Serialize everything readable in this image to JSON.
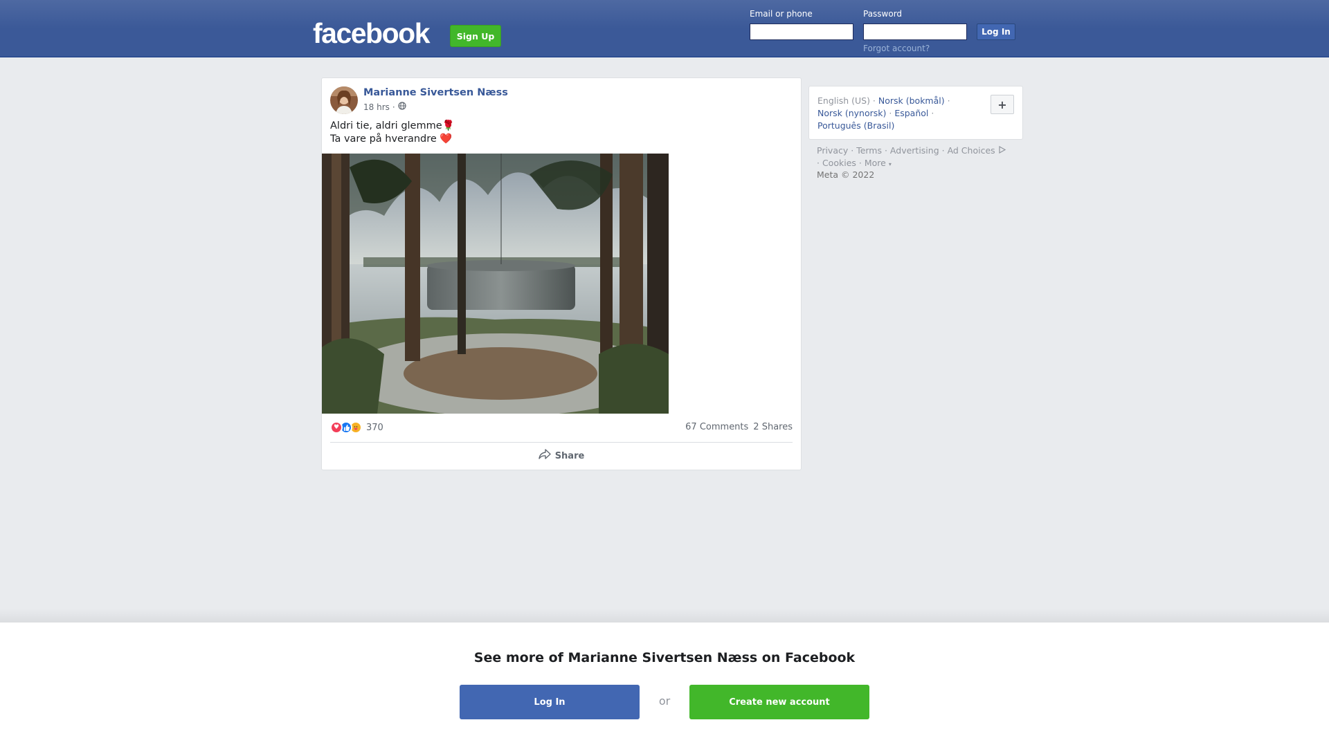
{
  "header": {
    "logo": "facebook",
    "signup_label": "Sign Up",
    "email_label": "Email or phone",
    "email_value": "",
    "password_label": "Password",
    "password_value": "",
    "login_label": "Log In",
    "forgot_label": "Forgot account?"
  },
  "post": {
    "author": "Marianne Sivertsen Næss",
    "time": "18 hrs",
    "privacy_icon": "globe-icon",
    "text_line1": "Aldri tie, aldri glemme🌹",
    "text_line2": "Ta vare på hverandre ❤️",
    "reactions": [
      "love-reaction-icon",
      "like-reaction-icon",
      "care-reaction-icon"
    ],
    "reaction_count": "370",
    "comments": "67 Comments",
    "shares": "2 Shares",
    "share_label": "Share"
  },
  "languages": {
    "current": "English (US)",
    "items": [
      "Norsk (bokmål)",
      "Norsk (nynorsk)",
      "Español",
      "Português (Brasil)"
    ],
    "more_button": "+"
  },
  "footer": {
    "links": [
      "Privacy",
      "Terms",
      "Advertising",
      "Ad Choices",
      "Cookies",
      "More"
    ],
    "copyright": "Meta © 2022"
  },
  "banner": {
    "title": "See more of Marianne Sivertsen Næss on Facebook",
    "login_label": "Log In",
    "or_label": "or",
    "create_label": "Create new account"
  },
  "colors": {
    "brand": "#3b5998",
    "link": "#385898",
    "green": "#42b72a",
    "button_blue": "#4267b2",
    "background": "#e9ebee"
  }
}
